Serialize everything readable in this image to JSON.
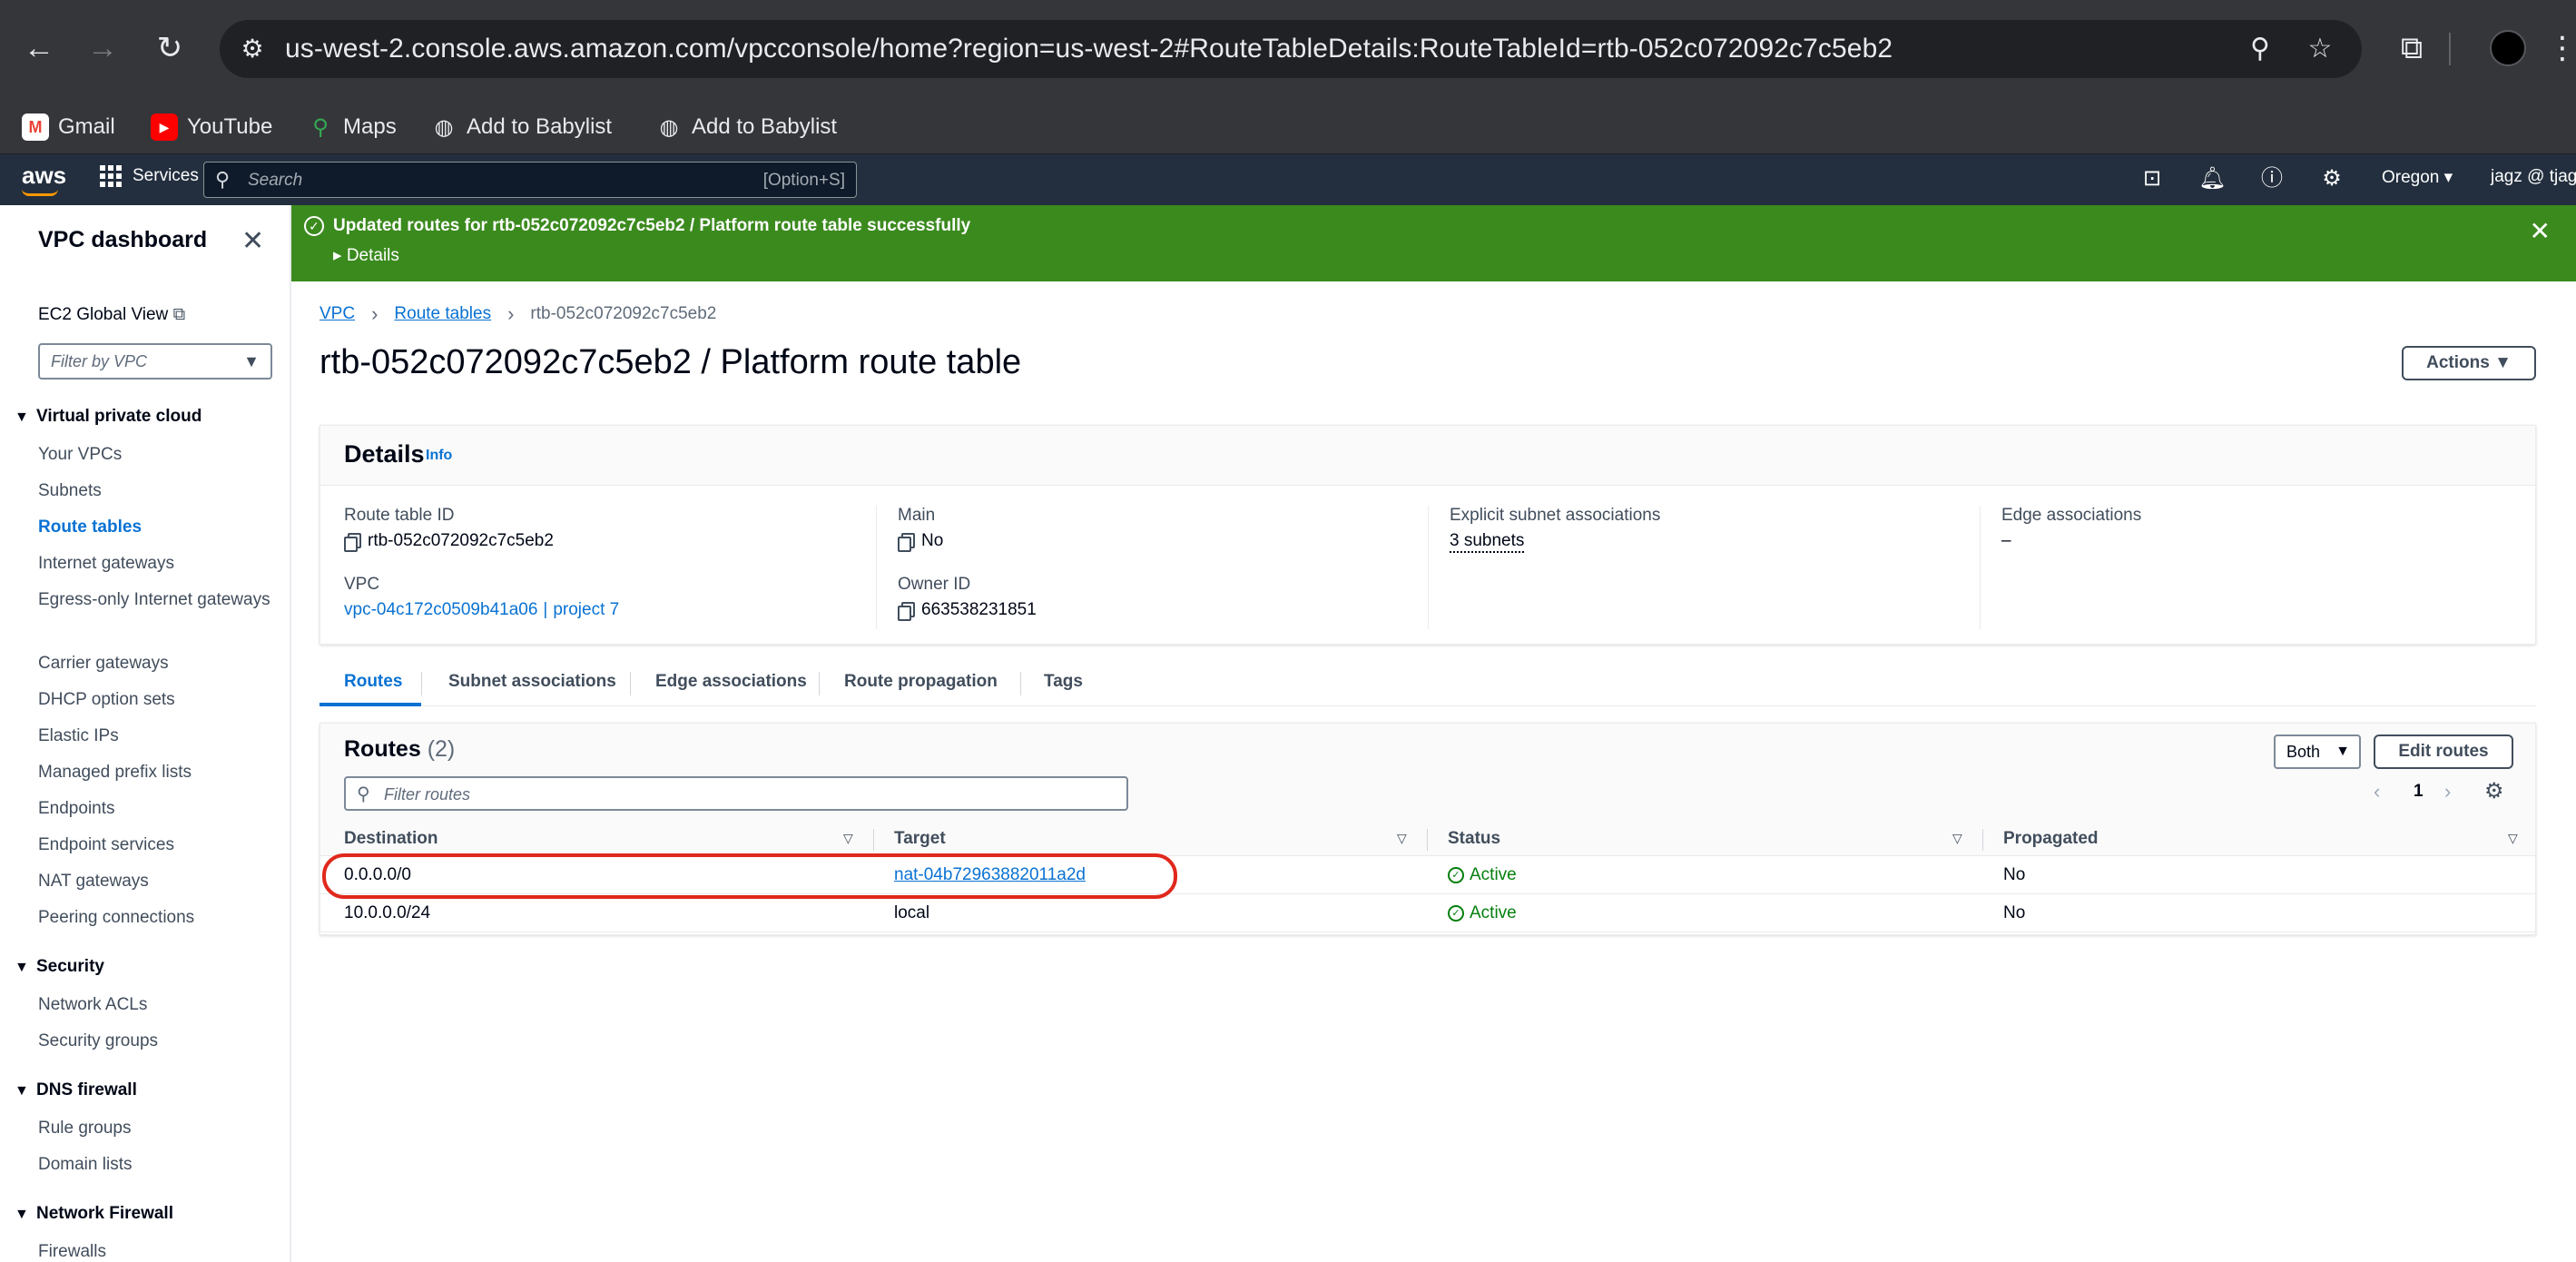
{
  "browser": {
    "url": "us-west-2.console.aws.amazon.com/vpcconsole/home?region=us-west-2#RouteTableDetails:RouteTableId=rtb-052c072092c7c5eb2",
    "bookmarks": [
      "Gmail",
      "YouTube",
      "Maps",
      "Add to Babylist",
      "Add to Babylist"
    ]
  },
  "aws_bar": {
    "logo": "aws",
    "services": "Services",
    "search_placeholder": "Search",
    "search_shortcut": "[Option+S]",
    "region": "Oregon",
    "account": "jagz @ tjagz"
  },
  "sidebar": {
    "title": "VPC dashboard",
    "ec2_global": "EC2 Global View",
    "filter_placeholder": "Filter by VPC",
    "sections": {
      "vpc": "Virtual private cloud",
      "security": "Security",
      "dns": "DNS firewall",
      "netfw": "Network Firewall"
    },
    "vpc_items": [
      "Your VPCs",
      "Subnets",
      "Route tables",
      "Internet gateways",
      "Egress-only Internet gateways",
      "Carrier gateways",
      "DHCP option sets",
      "Elastic IPs",
      "Managed prefix lists",
      "Endpoints",
      "Endpoint services",
      "NAT gateways",
      "Peering connections"
    ],
    "security_items": [
      "Network ACLs",
      "Security groups"
    ],
    "dns_items": [
      "Rule groups",
      "Domain lists"
    ],
    "netfw_items": [
      "Firewalls"
    ]
  },
  "flash": {
    "message": "Updated routes for rtb-052c072092c7c5eb2 / Platform route table successfully",
    "details": "Details"
  },
  "breadcrumb": {
    "vpc": "VPC",
    "route_tables": "Route tables",
    "current": "rtb-052c072092c7c5eb2"
  },
  "page": {
    "title": "rtb-052c072092c7c5eb2 / Platform route table",
    "actions": "Actions"
  },
  "details": {
    "heading": "Details",
    "info": "Info",
    "route_table_id_label": "Route table ID",
    "route_table_id": "rtb-052c072092c7c5eb2",
    "vpc_label": "VPC",
    "vpc_id": "vpc-04c172c0509b41a06",
    "vpc_sep": "|",
    "vpc_name": "project 7",
    "main_label": "Main",
    "main": "No",
    "owner_label": "Owner ID",
    "owner": "663538231851",
    "explicit_label": "Explicit subnet associations",
    "explicit": "3 subnets",
    "edge_label": "Edge associations",
    "edge": "–"
  },
  "tabs": [
    "Routes",
    "Subnet associations",
    "Edge associations",
    "Route propagation",
    "Tags"
  ],
  "routes": {
    "title": "Routes",
    "count": "(2)",
    "filter_placeholder": "Filter routes",
    "select_value": "Both",
    "edit_button": "Edit routes",
    "page": "1",
    "columns": [
      "Destination",
      "Target",
      "Status",
      "Propagated"
    ],
    "rows": [
      {
        "destination": "0.0.0.0/0",
        "target": "nat-04b72963882011a2d",
        "status": "Active",
        "propagated": "No"
      },
      {
        "destination": "10.0.0.0/24",
        "target": "local",
        "status": "Active",
        "propagated": "No"
      }
    ]
  },
  "colors": {
    "aws_bar": "#232f3e",
    "success_banner": "#3b8a1e",
    "link": "#0972d3",
    "status_active": "#037f0c",
    "highlight": "#e0281c"
  }
}
